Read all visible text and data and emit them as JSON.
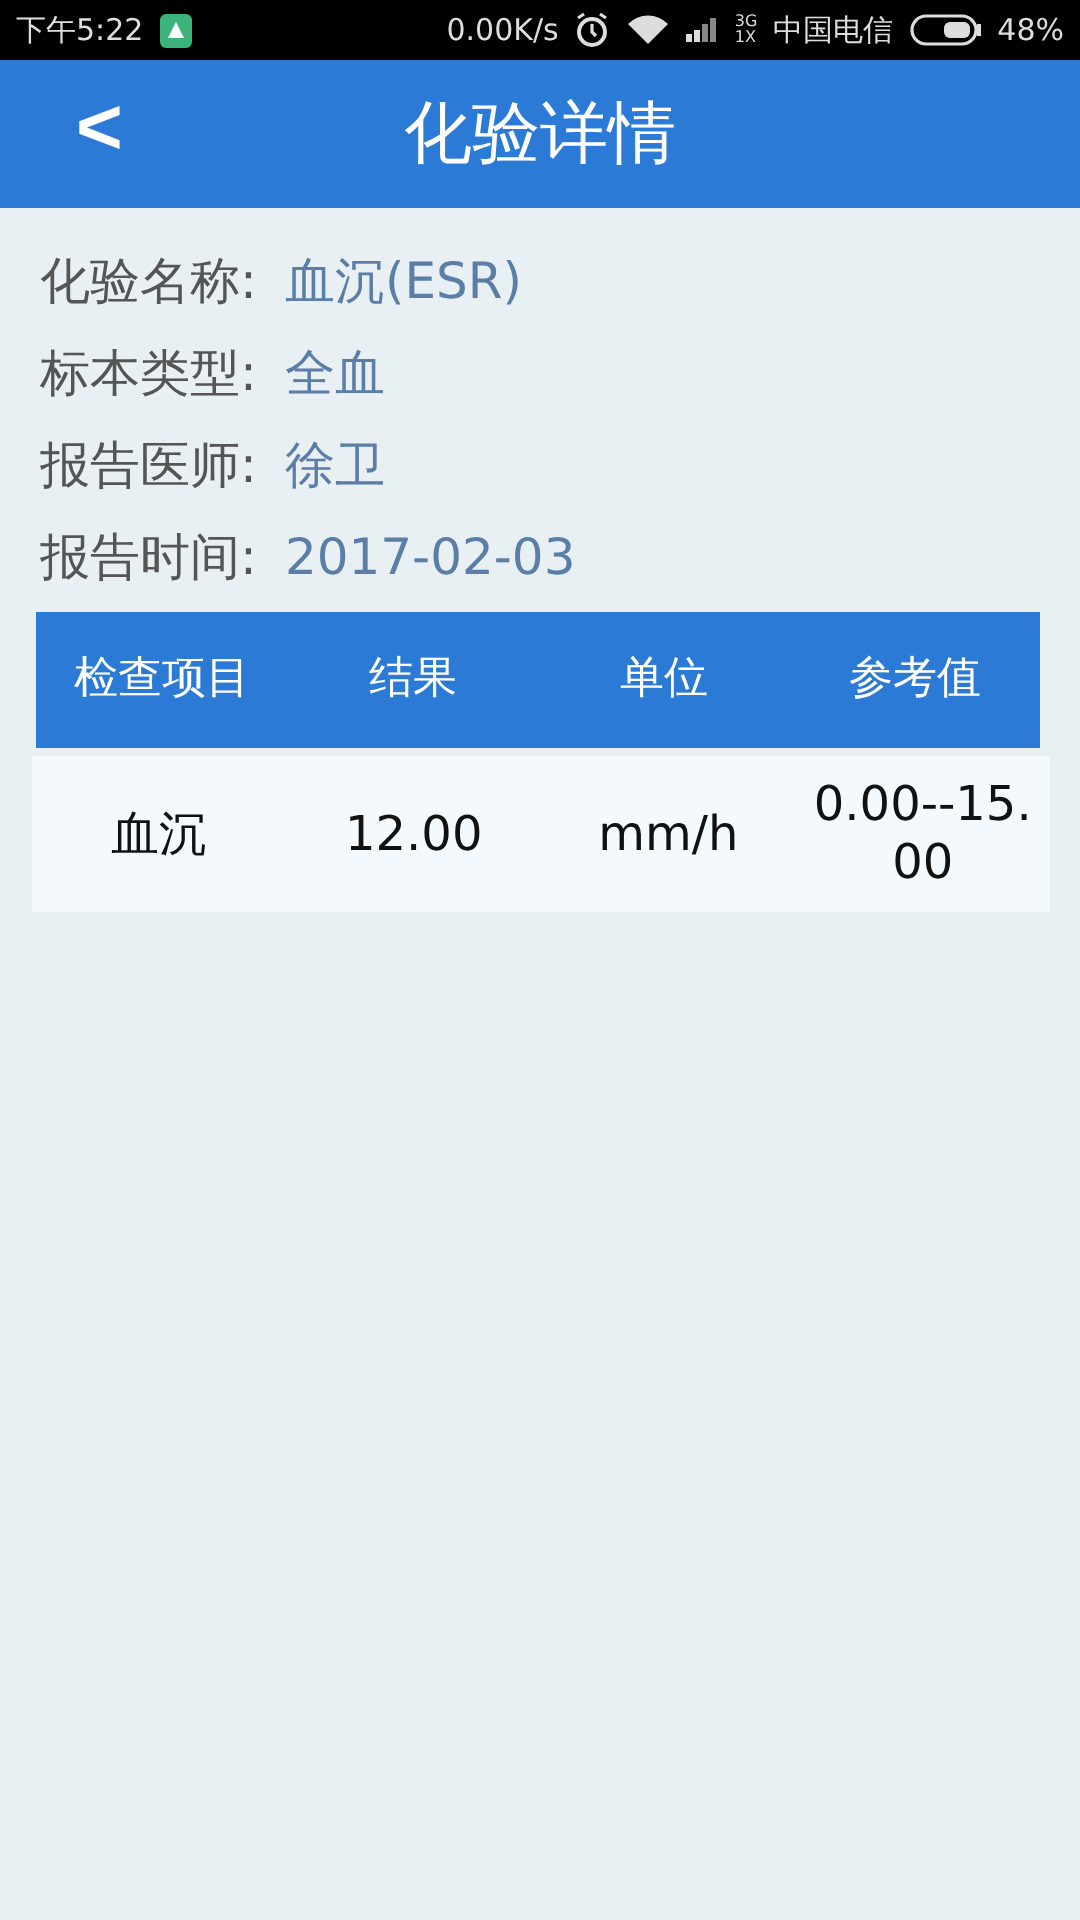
{
  "status_bar": {
    "time": "下午5:22",
    "speed": "0.00K/s",
    "network": [
      "3G",
      "1X"
    ],
    "carrier": "中国电信",
    "battery": "48%"
  },
  "header": {
    "back": "<",
    "title": "化验详情"
  },
  "info": [
    {
      "label": "化验名称:",
      "value": "血沉(ESR)"
    },
    {
      "label": "标本类型:",
      "value": "全血"
    },
    {
      "label": "报告医师:",
      "value": "徐卫"
    },
    {
      "label": "报告时间:",
      "value": "2017-02-03"
    }
  ],
  "table": {
    "columns": [
      "检查项目",
      "结果",
      "单位",
      "参考值"
    ],
    "rows": [
      [
        "血沉",
        "12.00",
        "mm/h",
        "0.00--15.00"
      ]
    ]
  }
}
